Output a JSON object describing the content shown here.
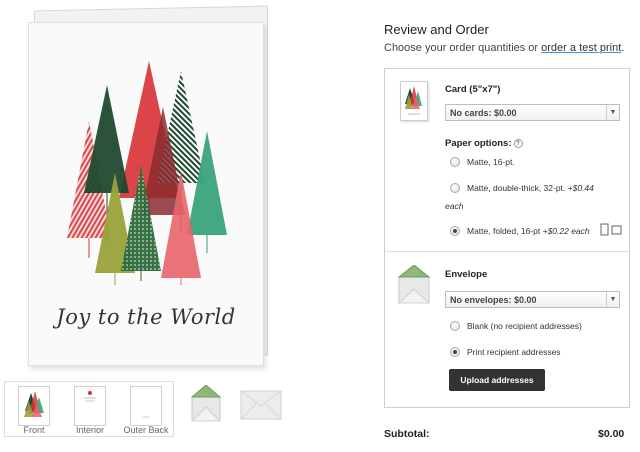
{
  "card": {
    "greeting": "Joy to the World"
  },
  "thumbnails": [
    {
      "label": "Front"
    },
    {
      "label": "Interior"
    },
    {
      "label": "Outer Back"
    }
  ],
  "review": {
    "title": "Review and Order",
    "subtitle_prefix": "Choose your order quantities or ",
    "subtitle_link": "order a test print",
    "subtitle_suffix": "."
  },
  "card_section": {
    "label": "Card (5\"x7\")",
    "select_value": "No cards: $0.00",
    "paper_label": "Paper options:",
    "help_icon": "?",
    "options": [
      {
        "label": "Matte, 16-pt.",
        "price": "",
        "suffix": "",
        "selected": false
      },
      {
        "label": "Matte, double-thick, 32-pt. ",
        "price": "+$0.44",
        "suffix": "each",
        "selected": false
      },
      {
        "label": "Matte, folded, 16-pt ",
        "price": "+$0.22 each",
        "suffix": "",
        "selected": true
      }
    ]
  },
  "envelope_section": {
    "label": "Envelope",
    "select_value": "No envelopes: $0.00",
    "options": [
      {
        "label": "Blank (no recipient addresses)",
        "selected": false
      },
      {
        "label": "Print recipient addresses",
        "selected": true
      }
    ],
    "upload_label": "Upload addresses"
  },
  "subtotal": {
    "label": "Subtotal:",
    "value": "$0.00"
  },
  "colors": {
    "tree_red": "#d8353a",
    "tree_dark_green": "#1f4a2e",
    "tree_green": "#3aa37a",
    "tree_olive": "#9aa23a",
    "tree_pink": "#e8636a",
    "envelope_green": "#8cb97a",
    "button_dark": "#333333"
  }
}
